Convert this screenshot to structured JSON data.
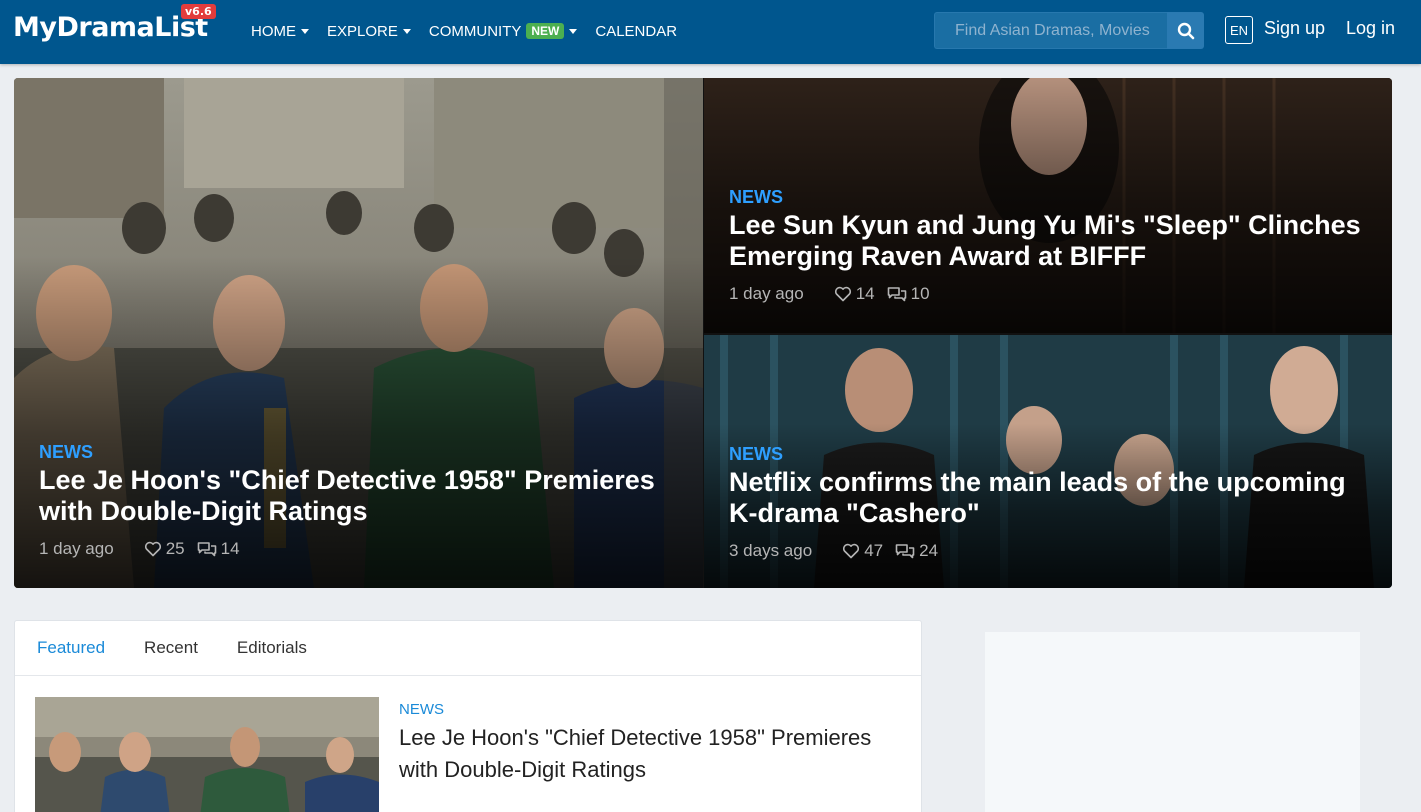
{
  "nav": {
    "logo_text": "MyDramaList",
    "version": "v6.6",
    "menu": [
      {
        "label": "HOME",
        "dropdown": true
      },
      {
        "label": "EXPLORE",
        "dropdown": true
      },
      {
        "label": "COMMUNITY",
        "badge": "NEW",
        "dropdown": true
      },
      {
        "label": "CALENDAR",
        "dropdown": false
      }
    ],
    "search_placeholder": "Find Asian Dramas, Movies",
    "lang": "EN",
    "signup": "Sign up",
    "login": "Log in",
    "colors": {
      "bar": "#00568e",
      "badge_new": "#4caf50",
      "version_badge": "#e23c3c"
    }
  },
  "hero": {
    "main": {
      "category": "NEWS",
      "title": "Lee Je Hoon's \"Chief Detective 1958\" Premieres with Double-Digit Ratings",
      "time": "1 day ago",
      "likes": "25",
      "comments": "14"
    },
    "side_top": {
      "category": "NEWS",
      "title": "Lee Sun Kyun and Jung Yu Mi's \"Sleep\" Clinches Emerging Raven Award at BIFFF",
      "time": "1 day ago",
      "likes": "14",
      "comments": "10"
    },
    "side_bottom": {
      "category": "NEWS",
      "title": "Netflix confirms the main leads of the upcoming K-drama \"Cashero\"",
      "time": "3 days ago",
      "likes": "47",
      "comments": "24"
    }
  },
  "feed": {
    "tabs": [
      "Featured",
      "Recent",
      "Editorials"
    ],
    "active_tab": "Featured",
    "article": {
      "category": "NEWS",
      "title": "Lee Je Hoon's \"Chief Detective 1958\" Premieres with Double-Digit Ratings"
    }
  }
}
